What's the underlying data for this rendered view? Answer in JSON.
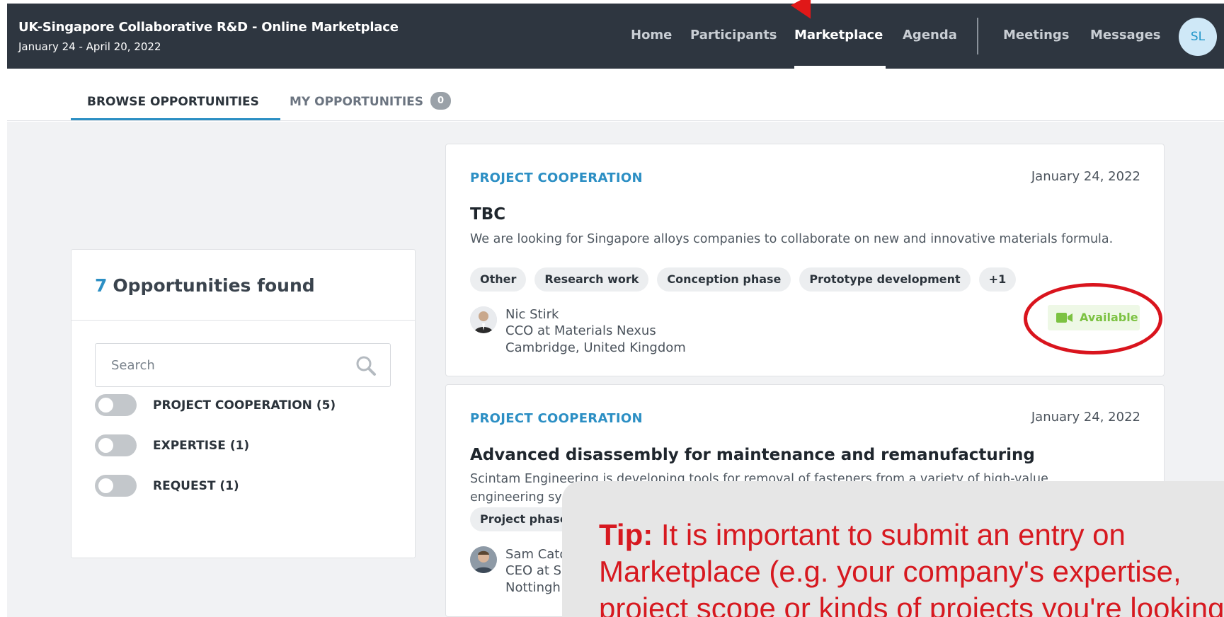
{
  "header": {
    "title": "UK-Singapore Collaborative R&D - Online Marketplace",
    "dates": "January 24 - April 20, 2022",
    "nav": [
      "Home",
      "Participants",
      "Marketplace",
      "Agenda",
      "Meetings",
      "Messages"
    ],
    "active_nav": "Marketplace",
    "avatar_initials": "SL"
  },
  "tabs": {
    "browse": "BROWSE OPPORTUNITIES",
    "mine": "MY OPPORTUNITIES",
    "mine_count": "0"
  },
  "filters": {
    "found_count": "7",
    "found_label": "Opportunities found",
    "search_placeholder": "Search",
    "items": [
      {
        "label": "PROJECT COOPERATION (5)",
        "on": false
      },
      {
        "label": "EXPERTISE (1)",
        "on": false
      },
      {
        "label": "REQUEST (1)",
        "on": false
      }
    ]
  },
  "opportunities": [
    {
      "category": "PROJECT COOPERATION",
      "date": "January 24, 2022",
      "title": "TBC",
      "description": "We are looking for Singapore alloys companies to collaborate on new and innovative materials formula.",
      "tags": [
        "Other",
        "Research work",
        "Conception phase",
        "Prototype development",
        "+1"
      ],
      "person": {
        "name": "Nic Stirk",
        "role": "CCO at Materials Nexus",
        "location": "Cambridge, United Kingdom"
      },
      "availability": "Available"
    },
    {
      "category": "PROJECT COOPERATION",
      "date": "January 24, 2022",
      "title": "Advanced disassembly for maintenance and remanufacturing",
      "description_line1": "Scintam Engineering is developing tools for removal of fasteners from a variety of high-value",
      "description_line2": "engineering sy",
      "tags": [
        "Project phase"
      ],
      "person": {
        "name": "Sam Cato",
        "role": "CEO at Sc",
        "location": "Nottingh"
      }
    }
  ],
  "tip": {
    "label": "Tip:",
    "line1": "It is important to submit an entry on",
    "line2": "Marketplace (e.g. your company's expertise,",
    "line3": "project scope or kinds of projects you're looking"
  },
  "colors": {
    "header_bg": "#2e3640",
    "accent": "#2c8fc4",
    "available": "#7cc242",
    "annotation_red": "#d9141d"
  }
}
